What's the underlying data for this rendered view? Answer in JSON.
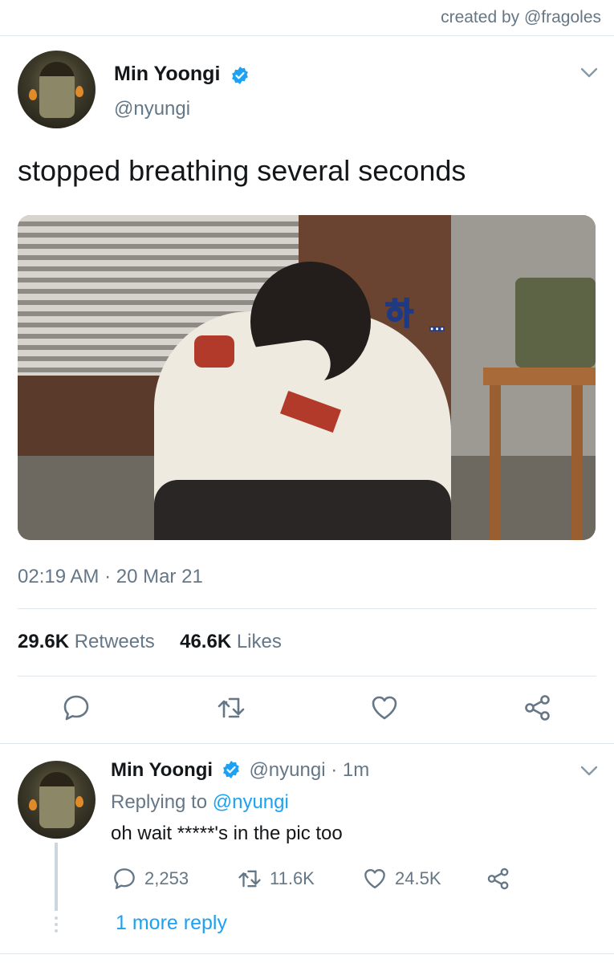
{
  "credit": "created by @fragoles",
  "tweet": {
    "author_name": "Min Yoongi",
    "author_handle": "@nyungi",
    "text": "stopped breathing several seconds",
    "image_caption_hangul": "하",
    "image_caption_dots": "...",
    "timestamp": "02:19 AM · 20 Mar 21",
    "retweets_count": "29.6K",
    "retweets_label": "Retweets",
    "likes_count": "46.6K",
    "likes_label": "Likes"
  },
  "reply": {
    "author_name": "Min Yoongi",
    "author_handle": "@nyungi",
    "age": " · 1m",
    "replying_prefix": "Replying to ",
    "replying_handle": "@nyungi",
    "text": "oh wait *****'s in the pic too",
    "reply_count": "2,253",
    "retweet_count": "11.6K",
    "like_count": "24.5K",
    "more_replies": "1 more reply"
  },
  "icons": {
    "verified": "verified-badge-icon",
    "chevron": "chevron-down-icon",
    "reply": "reply-bubble-icon",
    "retweet": "retweet-icon",
    "like": "heart-icon",
    "share": "share-icon"
  },
  "colors": {
    "accent": "#1da1f2",
    "muted": "#657786",
    "divider": "#e1e8ed",
    "text": "#14171a"
  }
}
